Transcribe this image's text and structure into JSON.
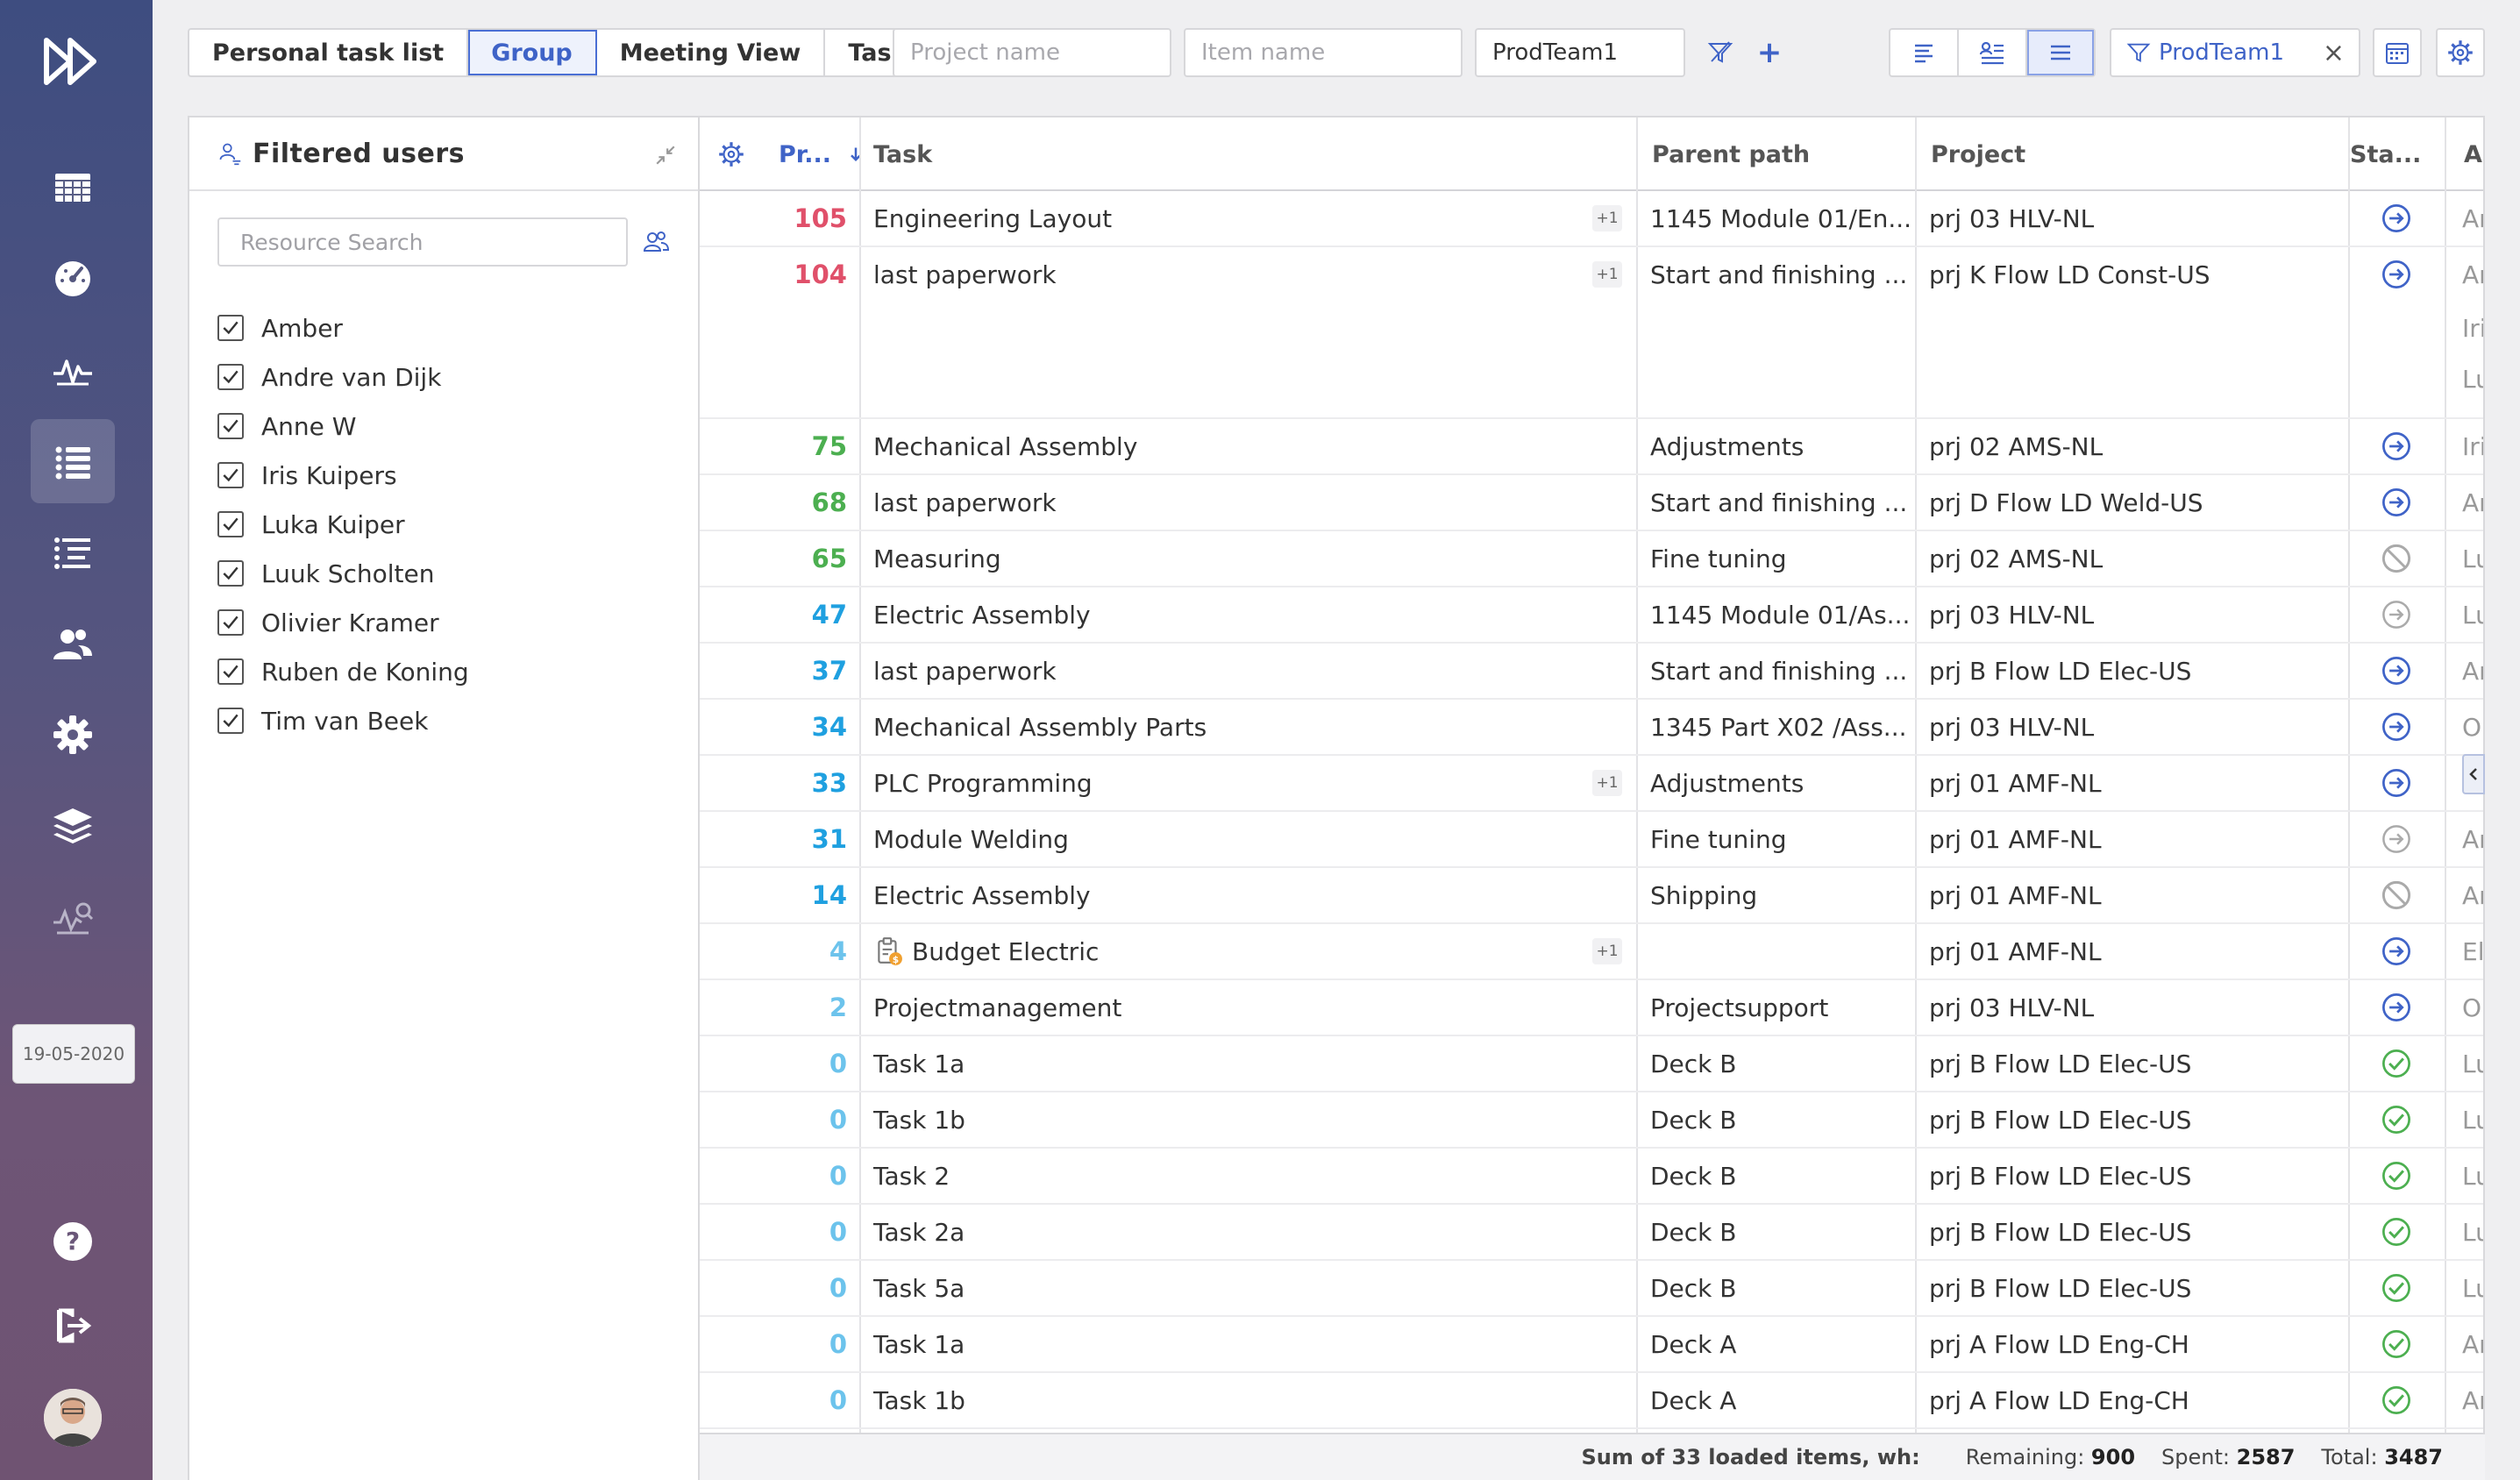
{
  "sidebar": {
    "date": "19-05-2020",
    "icons": [
      "logo-icon",
      "calendar-grid-icon",
      "dashboard-gauge-icon",
      "activity-icon",
      "task-list-icon",
      "gantt-list-icon",
      "users-icon",
      "gear-icon",
      "layers-icon",
      "analytics-icon",
      "help-icon",
      "logout-icon"
    ]
  },
  "top": {
    "tabs": [
      "Personal task list",
      "Group",
      "Meeting View",
      "Task List"
    ],
    "active_tab": "Group",
    "project_placeholder": "Project name",
    "item_placeholder": "Item name",
    "team_value": "ProdTeam1",
    "add_label": "+",
    "team_chip": "ProdTeam1",
    "close_label": "×"
  },
  "panel": {
    "title": "Filtered users",
    "search_placeholder": "Resource Search",
    "users": [
      "Amber",
      "Andre van Dijk",
      "Anne W",
      "Iris Kuipers",
      "Luka Kuiper",
      "Luuk Scholten",
      "Olivier Kramer",
      "Ruben de Koning",
      "Tim van Beek"
    ]
  },
  "table": {
    "headers": {
      "priority": "Pr...",
      "task": "Task",
      "parent": "Parent path",
      "project": "Project",
      "status": "Sta...",
      "assignee": "As"
    },
    "rows": [
      {
        "pr": "105",
        "color": "#e0506a",
        "task": "Engineering Layout",
        "plus": "+1",
        "parent": "1145 Module 01/En...",
        "project": "prj 03 HLV-NL",
        "status": "active",
        "assignee": "Ar"
      },
      {
        "pr": "104",
        "color": "#e0506a",
        "task": "last paperwork",
        "plus": "+1",
        "parent": "Start and finishing ...",
        "project": "prj K Flow LD Const-US",
        "status": "active",
        "assignee": "Ar",
        "extra": [
          "Iri",
          "Lu"
        ]
      },
      {
        "pr": "75",
        "color": "#4caf50",
        "task": "Mechanical Assembly",
        "plus": "",
        "parent": "Adjustments",
        "project": "prj 02 AMS-NL",
        "status": "active",
        "assignee": "Iri"
      },
      {
        "pr": "68",
        "color": "#4caf50",
        "task": "last paperwork",
        "plus": "",
        "parent": "Start and finishing ...",
        "project": "prj D Flow LD Weld-US",
        "status": "active",
        "assignee": "Ar"
      },
      {
        "pr": "65",
        "color": "#4caf50",
        "task": "Measuring",
        "plus": "",
        "parent": "Fine tuning",
        "project": "prj 02 AMS-NL",
        "status": "blocked",
        "assignee": "Lu"
      },
      {
        "pr": "47",
        "color": "#1fa0e0",
        "task": "Electric Assembly",
        "plus": "",
        "parent": "1145 Module 01/As...",
        "project": "prj 03 HLV-NL",
        "status": "pending",
        "assignee": "Lu"
      },
      {
        "pr": "37",
        "color": "#1fa0e0",
        "task": "last paperwork",
        "plus": "",
        "parent": "Start and finishing ...",
        "project": "prj B Flow LD Elec-US",
        "status": "active",
        "assignee": "Ar"
      },
      {
        "pr": "34",
        "color": "#1fa0e0",
        "task": "Mechanical Assembly Parts",
        "plus": "",
        "parent": "1345 Part X02 /Ass...",
        "project": "prj 03 HLV-NL",
        "status": "active",
        "assignee": "O"
      },
      {
        "pr": "33",
        "color": "#1fa0e0",
        "task": "PLC Programming",
        "plus": "+1",
        "parent": "Adjustments",
        "project": "prj 01 AMF-NL",
        "status": "active",
        "assignee": ""
      },
      {
        "pr": "31",
        "color": "#1fa0e0",
        "task": "Module Welding",
        "plus": "",
        "parent": "Fine tuning",
        "project": "prj 01 AMF-NL",
        "status": "pending",
        "assignee": "Ar"
      },
      {
        "pr": "14",
        "color": "#1fa0e0",
        "task": "Electric Assembly",
        "plus": "",
        "parent": "Shipping",
        "project": "prj 01 AMF-NL",
        "status": "blocked",
        "assignee": "Ar"
      },
      {
        "pr": "4",
        "color": "#6cc3ec",
        "task": "Budget Electric",
        "plus": "+1",
        "parent": "",
        "project": "prj 01 AMF-NL",
        "status": "active",
        "assignee": "El",
        "budget": true
      },
      {
        "pr": "2",
        "color": "#6cc3ec",
        "task": "Projectmanagement",
        "plus": "",
        "parent": "Projectsupport",
        "project": "prj 03 HLV-NL",
        "status": "active",
        "assignee": "O"
      },
      {
        "pr": "0",
        "color": "#6cc3ec",
        "task": "Task 1a",
        "plus": "",
        "parent": "Deck B",
        "project": "prj B Flow LD Elec-US",
        "status": "done",
        "assignee": "Lu"
      },
      {
        "pr": "0",
        "color": "#6cc3ec",
        "task": "Task 1b",
        "plus": "",
        "parent": "Deck B",
        "project": "prj B Flow LD Elec-US",
        "status": "done",
        "assignee": "Lu"
      },
      {
        "pr": "0",
        "color": "#6cc3ec",
        "task": "Task 2",
        "plus": "",
        "parent": "Deck B",
        "project": "prj B Flow LD Elec-US",
        "status": "done",
        "assignee": "Lu"
      },
      {
        "pr": "0",
        "color": "#6cc3ec",
        "task": "Task 2a",
        "plus": "",
        "parent": "Deck B",
        "project": "prj B Flow LD Elec-US",
        "status": "done",
        "assignee": "Lu"
      },
      {
        "pr": "0",
        "color": "#6cc3ec",
        "task": "Task 5a",
        "plus": "",
        "parent": "Deck B",
        "project": "prj B Flow LD Elec-US",
        "status": "done",
        "assignee": "Lu"
      },
      {
        "pr": "0",
        "color": "#6cc3ec",
        "task": "Task 1a",
        "plus": "",
        "parent": "Deck A",
        "project": "prj A Flow LD Eng-CH",
        "status": "done",
        "assignee": "Ar"
      },
      {
        "pr": "0",
        "color": "#6cc3ec",
        "task": "Task 1b",
        "plus": "",
        "parent": "Deck A",
        "project": "prj A Flow LD Eng-CH",
        "status": "done",
        "assignee": "Ar"
      }
    ]
  },
  "footer": {
    "label": "Sum of 33 loaded items, wh:",
    "remaining_label": "Remaining:",
    "remaining": "900",
    "spent_label": "Spent:",
    "spent": "2587",
    "total_label": "Total:",
    "total": "3487"
  },
  "colors": {
    "accent": "#3f63c7",
    "active_status": "#3f63c7",
    "done_status": "#4caf50",
    "inactive_status": "#aaaaaa"
  }
}
